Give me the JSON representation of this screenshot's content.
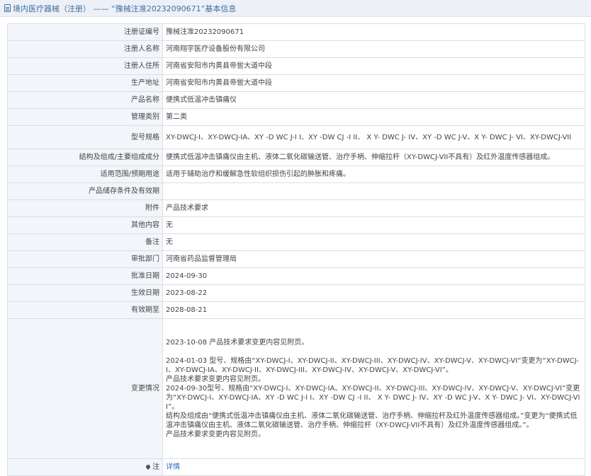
{
  "header": {
    "title": "境内医疗器械（注册） —— “豫械注准20232090671”基本信息"
  },
  "rows": [
    {
      "label": "注册证编号",
      "value": "豫械注准20232090671"
    },
    {
      "label": "注册人名称",
      "value": "河南翔宇医疗设备股份有限公司"
    },
    {
      "label": "注册人住所",
      "value": "河南省安阳市内黄县帝喾大道中段"
    },
    {
      "label": "生产地址",
      "value": "河南省安阳市内黄县帝喾大道中段"
    },
    {
      "label": "产品名称",
      "value": "便携式低温冲击镇痛仪"
    },
    {
      "label": "管理类别",
      "value": "第二类"
    },
    {
      "label": "型号规格",
      "value": "XY-DWCJ-I、XY-DWCJ-IA、XY -D WC J-I I、XY -DW CJ -I II、 X Y- DWC J- IV、XY -D WC J-V、X Y- DWC J- VI、XY-DWCJ-VII"
    },
    {
      "label": "结构及组成/主要组成成分",
      "value": "便携式低温冲击镇痛仪由主机、液体二氧化碳输送管、治疗手柄、伸缩拉杆（XY-DWCJ-VII不具有）及红外温度传感器组成。"
    },
    {
      "label": "适用范围/预期用途",
      "value": "适用于辅助治疗和缓解急性软组织损伤引起的肿胀和疼痛。"
    },
    {
      "label": "产品储存条件及有效期",
      "value": ""
    },
    {
      "label": "附件",
      "value": "产品技术要求"
    },
    {
      "label": "其他内容",
      "value": "无"
    },
    {
      "label": "备注",
      "value": "无"
    },
    {
      "label": "审批部门",
      "value": "河南省药品监督管理局"
    },
    {
      "label": "批准日期",
      "value": "2024-09-30"
    },
    {
      "label": "生效日期",
      "value": "2023-08-22"
    },
    {
      "label": "有效期至",
      "value": "2028-08-21"
    }
  ],
  "changes": {
    "label": "变更情况",
    "p1": "2023-10-08 产品技术要求变更内容见附页。",
    "p2": "2024-01-03 型号、规格由“XY-DWCJ-I、XY-DWCJ-II、XY-DWCJ-III、XY-DWCJ-IV、XY-DWCJ-V、XY-DWCJ-VI”变更为“XY-DWCJ-I、XY-DWCJ-IA、XY-DWCJ-II、XY-DWCJ-III、XY-DWCJ-IV、XY-DWCJ-V、XY-DWCJ-VI”。",
    "p3": "产品技术要求变更内容见附页。",
    "p4": "2024-09-30型号、规格由“XY-DWCJ-I、XY-DWCJ-IA、XY-DWCJ-II、XY-DWCJ-III、XY-DWCJ-IV、XY-DWCJ-V、XY-DWCJ-VI”变更为“XY-DWCJ-I、XY-DWCJ-IA、XY -D WC J-I I、XY -DW CJ -I II、 X Y- DWC J- IV、XY -D WC J-V、X Y- DWC J- VI、XY-DWCJ-VII”。",
    "p5": "结构及组成由“便携式低温冲击镇痛仪由主机、液体二氧化碳输送管、治疗手柄、伸缩拉杆及红外温度传感器组成。”变更为“便携式低温冲击镇痛仪由主机、液体二氧化碳输送管、治疗手柄、伸缩拉杆（XY-DWCJ-VII不具有）及红外温度传感器组成。”。",
    "p6": "产品技术要求变更内容见附页。"
  },
  "note": {
    "label": "注",
    "link": "详情",
    "icon": "pin-icon"
  }
}
